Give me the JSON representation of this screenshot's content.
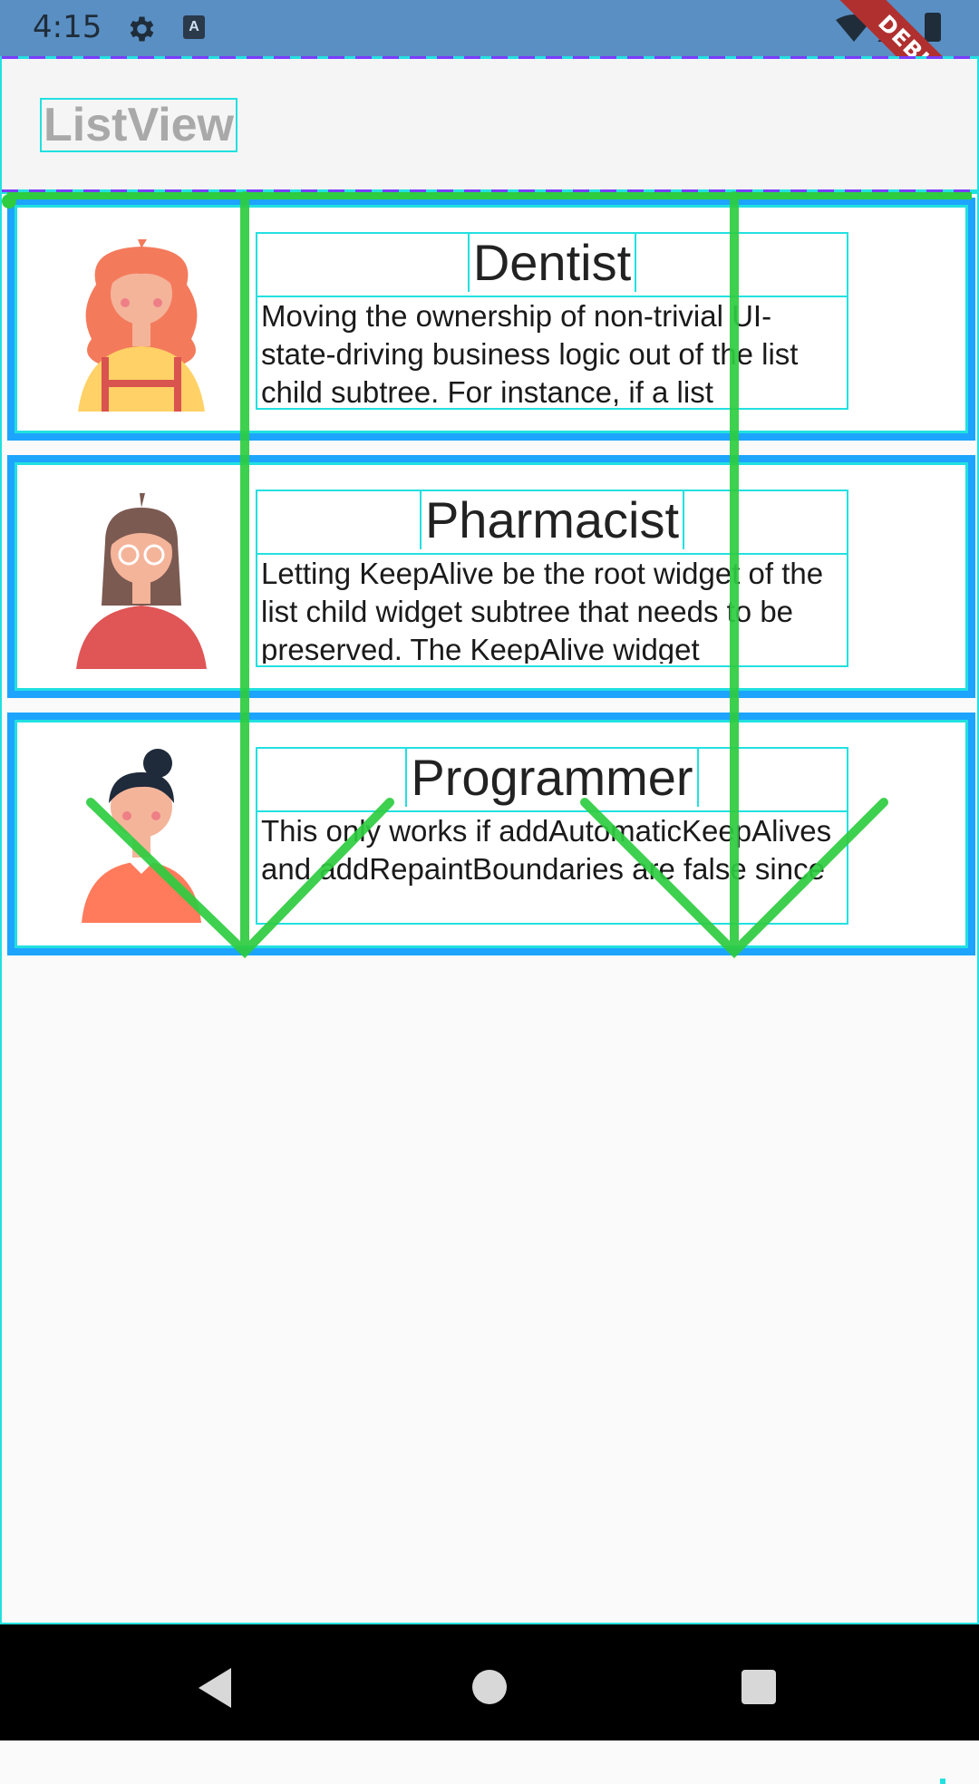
{
  "status_bar": {
    "time": "4:15",
    "icons": [
      "gear-icon",
      "keyboard-a-icon",
      "wifi-icon",
      "signal-icon",
      "battery-icon"
    ]
  },
  "debug_banner": "DEBUG",
  "app_bar": {
    "title": "ListView"
  },
  "list": {
    "items": [
      {
        "title": "Dentist",
        "description": "Moving the ownership of non-trivial UI-state-driving business logic out of the list child subtree. For instance, if a list",
        "avatar": "woman-avatar-red-hair"
      },
      {
        "title": "Pharmacist",
        "description": "Letting KeepAlive be the root widget of the list child widget subtree that needs to be preserved. The KeepAlive widget",
        "avatar": "woman-avatar-glasses"
      },
      {
        "title": "Programmer",
        "description": "This only works if addAutomaticKeepAlives and addRepaintBoundaries are false since",
        "avatar": "woman-avatar-bun"
      }
    ]
  },
  "nav_bar": {
    "icons": [
      "back-icon",
      "home-icon",
      "recents-icon"
    ]
  },
  "colors": {
    "status_bar": "#5a8fc3",
    "debug_overlay_cyan": "#22e0e0",
    "card_border": "#1da4ff",
    "scroll_arrow_green": "#2ecc40",
    "debug_banner": "#b03030"
  }
}
